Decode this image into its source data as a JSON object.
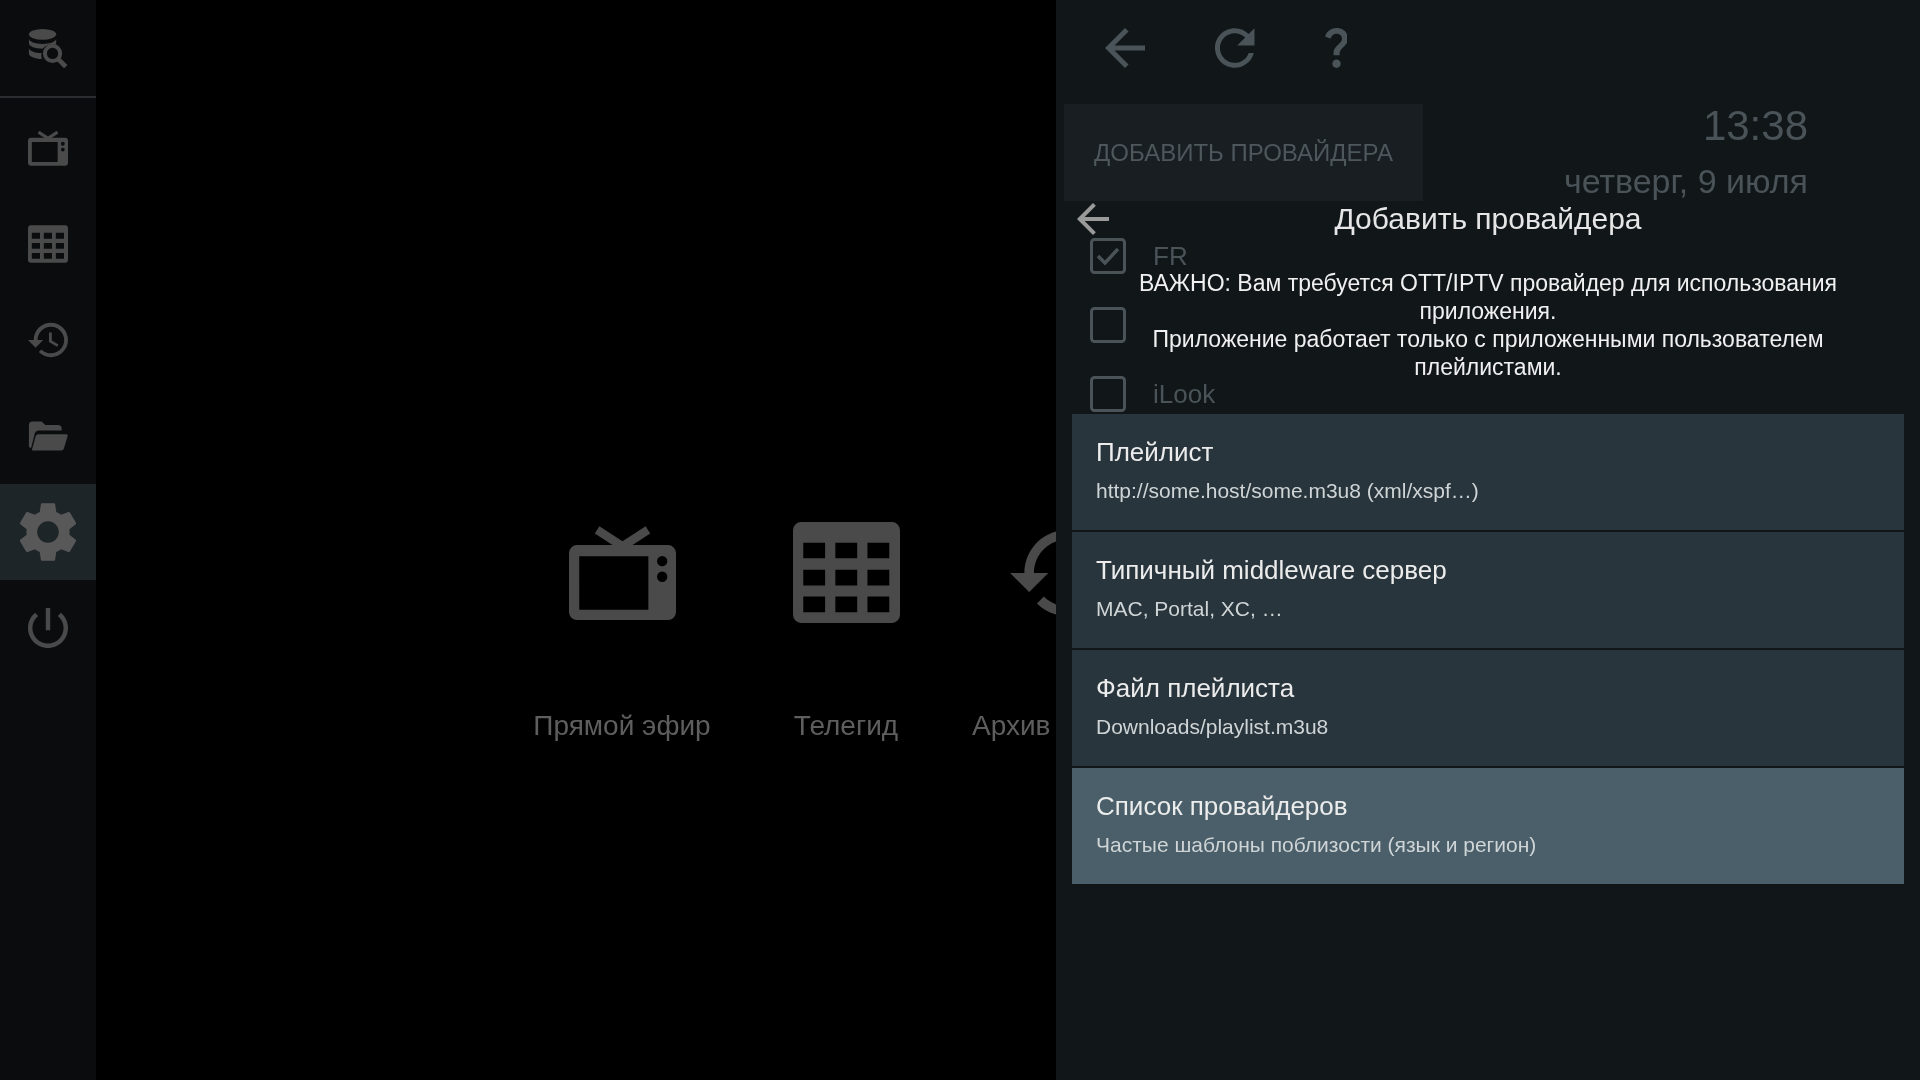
{
  "sidebar": {
    "items": [
      {
        "selected": false
      },
      {
        "selected": false
      },
      {
        "selected": false
      },
      {
        "selected": false
      },
      {
        "selected": false
      },
      {
        "selected": true
      },
      {
        "selected": false
      }
    ]
  },
  "home": {
    "items": [
      {
        "label": "Прямой эфир"
      },
      {
        "label": "Телегид"
      },
      {
        "label": "Архив"
      }
    ]
  },
  "settings_page": {
    "add_button": "ДОБАВИТЬ ПРОВАЙДЕРА",
    "clock": "13:38",
    "date": "четверг, 9 июля",
    "providers": [
      {
        "label": "FR",
        "checked": true
      },
      {
        "checked": false
      },
      {
        "label": "iLook",
        "checked": false
      }
    ]
  },
  "dialog": {
    "title": "Добавить провайдера",
    "notice": [
      "ВАЖНО: Вам требуется OTT/IPTV провайдер для использования приложения.",
      "Приложение работает только с приложенными пользователем плейлистами."
    ],
    "options": [
      {
        "title": "Плейлист",
        "subtitle": "http://some.host/some.m3u8 (xml/xspf…)",
        "selected": false
      },
      {
        "title": "Типичный middleware сервер",
        "subtitle": "MAC, Portal, XC, …",
        "selected": false
      },
      {
        "title": "Файл плейлиста",
        "subtitle": "Downloads/playlist.m3u8",
        "selected": false
      },
      {
        "title": "Список провайдеров",
        "subtitle": "Частые шаблоны поблизости (язык и регион)",
        "selected": true
      }
    ]
  }
}
